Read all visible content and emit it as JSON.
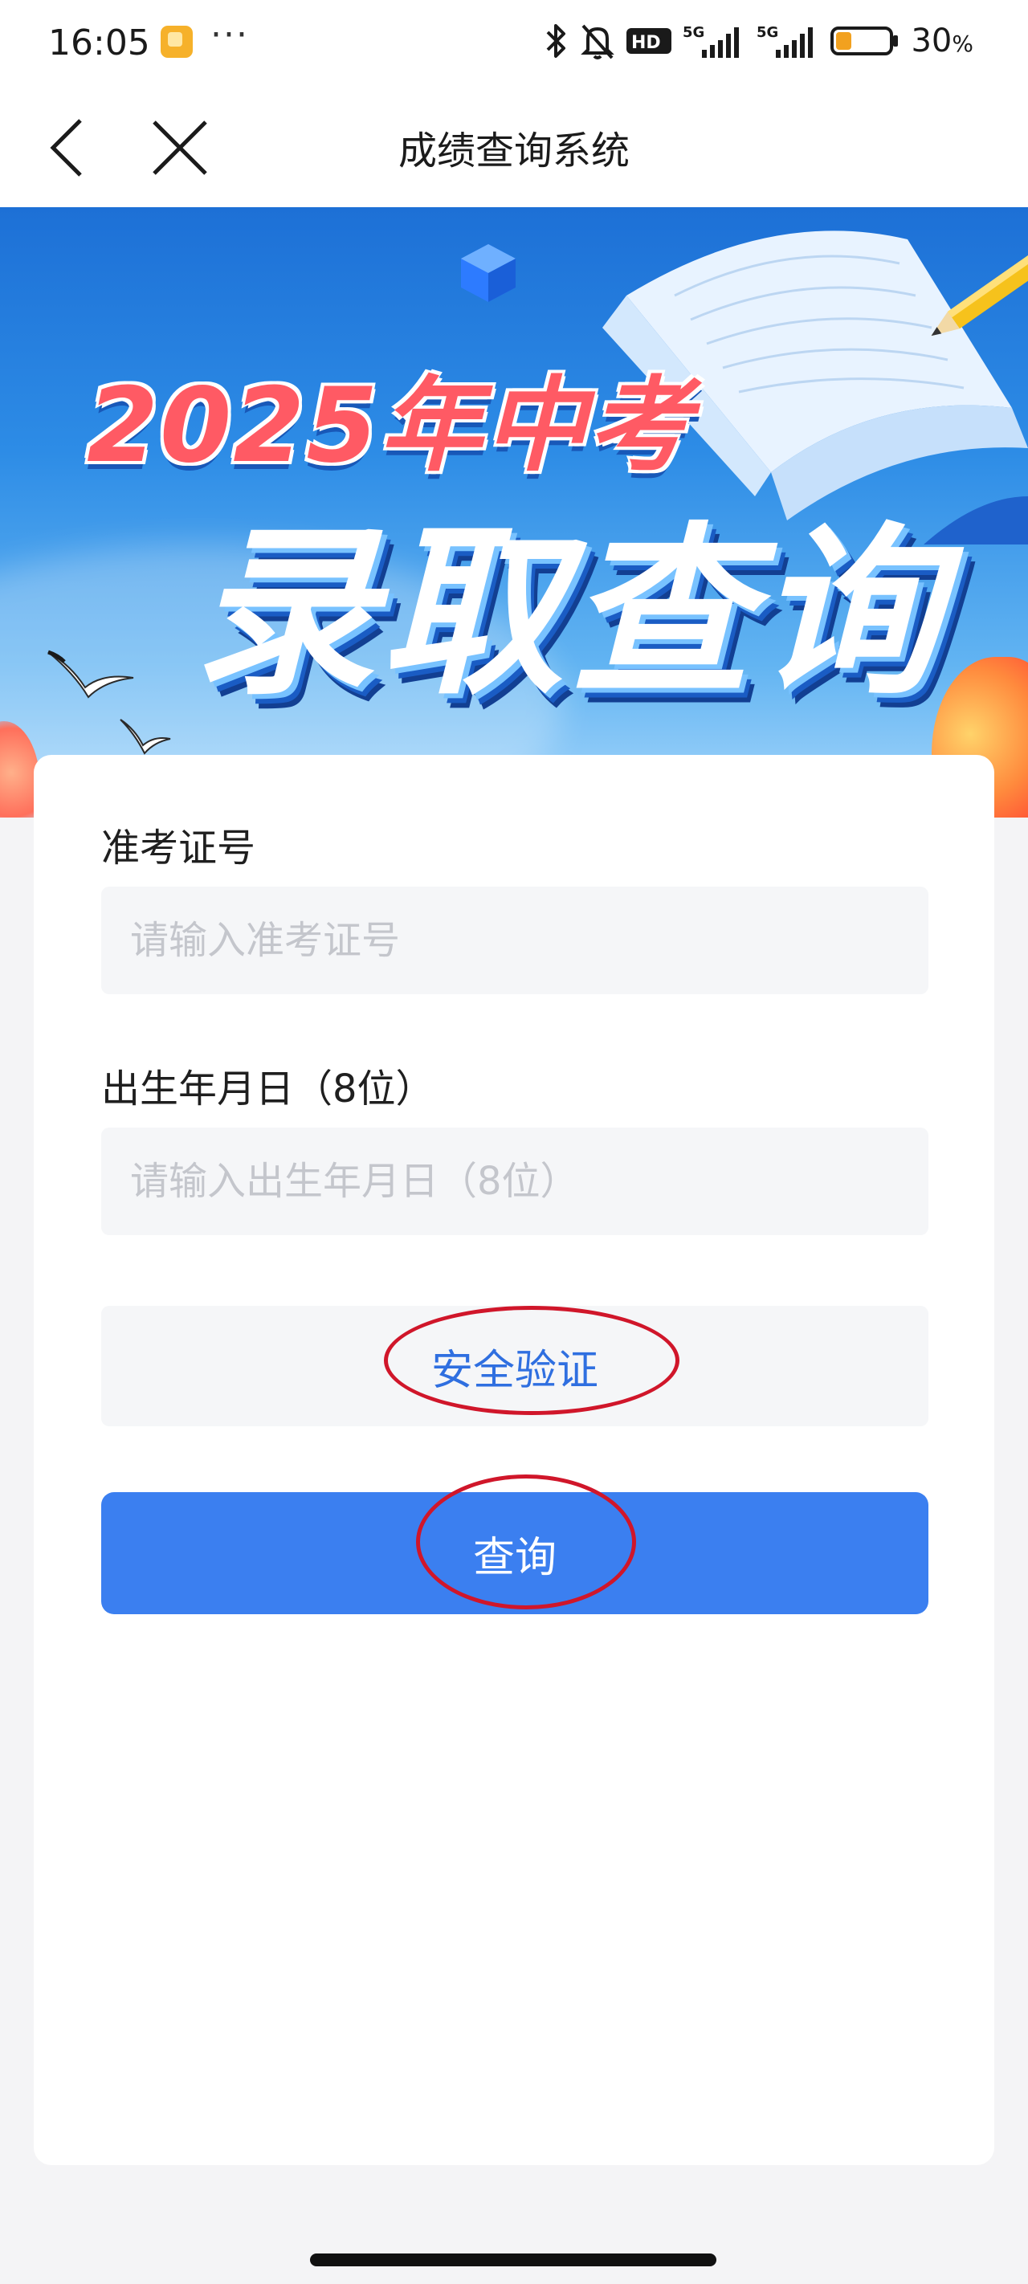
{
  "status_bar": {
    "time": "16:05",
    "more": "···",
    "battery_level": "30",
    "battery_unit": "%",
    "battery_fraction": 0.3,
    "icons": [
      "bluetooth-icon",
      "silent-bell-icon",
      "hd-icon",
      "signal-5g-icon",
      "signal-5g-icon",
      "battery-icon"
    ]
  },
  "title_bar": {
    "title": "成绩查询系统"
  },
  "banner": {
    "year_text": "2025年中考",
    "main_text": "录取查询"
  },
  "form": {
    "ticket_label": "准考证号",
    "ticket_placeholder": "请输入准考证号",
    "ticket_value": "",
    "birth_label": "出生年月日（8位）",
    "birth_placeholder": "请输入出生年月日（8位）",
    "birth_value": "",
    "verify_label": "安全验证",
    "query_label": "查询"
  },
  "colors": {
    "primary": "#3b7ff0",
    "link": "#2f6fe0",
    "annotation": "#d0162a",
    "banner": "#2d8ce6",
    "input_bg": "#f5f6f8"
  }
}
